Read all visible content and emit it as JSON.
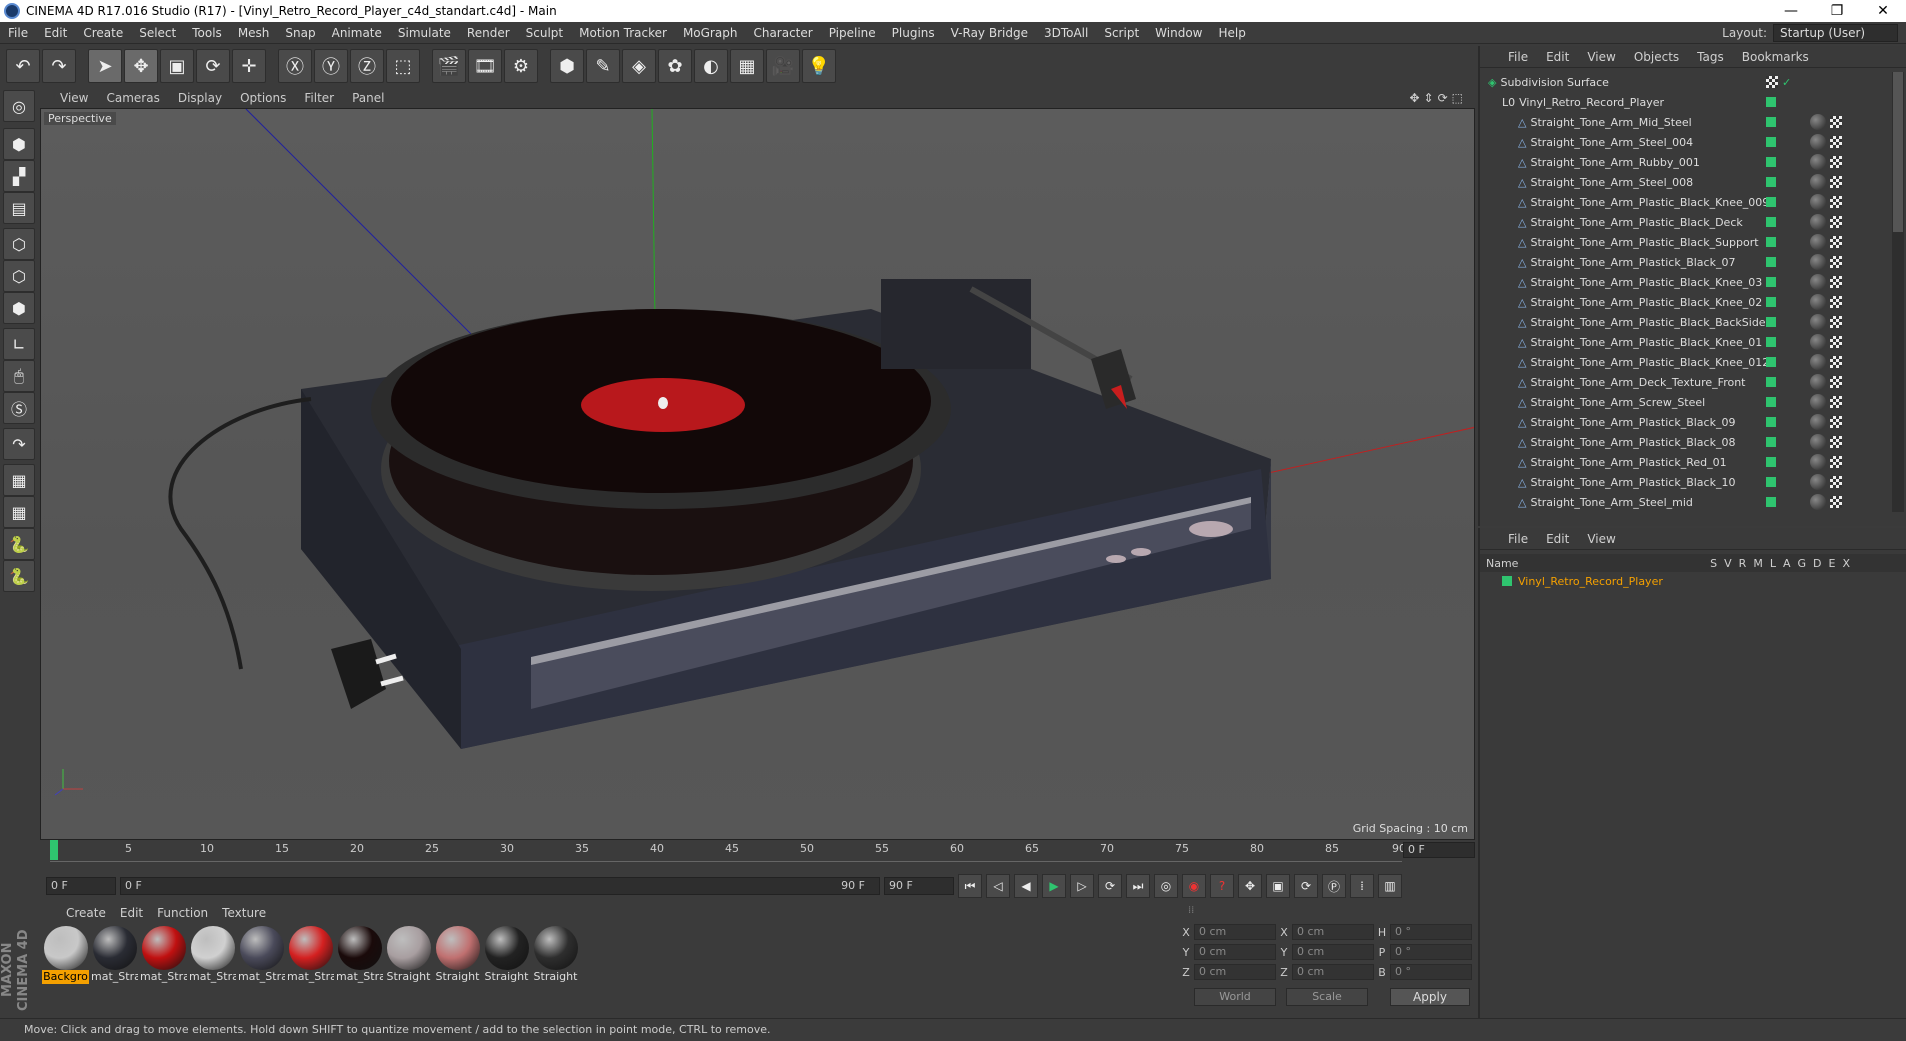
{
  "window": {
    "title": "CINEMA 4D R17.016 Studio (R17) - [Vinyl_Retro_Record_Player_c4d_standart.c4d] - Main"
  },
  "menu": [
    "File",
    "Edit",
    "Create",
    "Select",
    "Tools",
    "Mesh",
    "Snap",
    "Animate",
    "Simulate",
    "Render",
    "Sculpt",
    "Motion Tracker",
    "MoGraph",
    "Character",
    "Pipeline",
    "Plugins",
    "V-Ray Bridge",
    "3DToAll",
    "Script",
    "Window",
    "Help"
  ],
  "layout": {
    "label": "Layout:",
    "value": "Startup (User)"
  },
  "viewport": {
    "menu": [
      "View",
      "Cameras",
      "Display",
      "Options",
      "Filter",
      "Panel"
    ],
    "camera": "Perspective",
    "grid_spacing": "Grid Spacing : 10 cm"
  },
  "timeline": {
    "ticks": [
      "0",
      "5",
      "10",
      "15",
      "20",
      "25",
      "30",
      "35",
      "40",
      "45",
      "50",
      "55",
      "60",
      "65",
      "70",
      "75",
      "80",
      "85",
      "90"
    ],
    "current_frame": "0 F",
    "start": "0 F",
    "range_start": "0 F",
    "range_end": "90 F",
    "end": "90 F"
  },
  "materials": {
    "menu": [
      "Create",
      "Edit",
      "Function",
      "Texture"
    ],
    "items": [
      {
        "label": "Backgro",
        "color": "#c8c8c8"
      },
      {
        "label": "mat_Stra",
        "color": "#2a2c34"
      },
      {
        "label": "mat_Stra",
        "color": "#c01010"
      },
      {
        "label": "mat_Stra",
        "color": "#d0d0d0"
      },
      {
        "label": "mat_Stra",
        "color": "#4a4a5a"
      },
      {
        "label": "mat_Stra",
        "color": "#d42020"
      },
      {
        "label": "mat_Stra",
        "color": "#1a0a0a"
      },
      {
        "label": "Straight",
        "color": "#a89ea0"
      },
      {
        "label": "Straight",
        "color": "#c07070"
      },
      {
        "label": "Straight",
        "color": "#222"
      },
      {
        "label": "Straight",
        "color": "#2e2e2e"
      }
    ]
  },
  "coords": {
    "rows": [
      {
        "a": "X",
        "av": "0 cm",
        "b": "X",
        "bv": "0 cm",
        "c": "H",
        "cv": "0 °"
      },
      {
        "a": "Y",
        "av": "0 cm",
        "b": "Y",
        "bv": "0 cm",
        "c": "P",
        "cv": "0 °"
      },
      {
        "a": "Z",
        "av": "0 cm",
        "b": "Z",
        "bv": "0 cm",
        "c": "B",
        "cv": "0 °"
      }
    ],
    "mode": "World",
    "transform": "Scale",
    "apply": "Apply"
  },
  "status": "Move: Click and drag to move elements. Hold down SHIFT to quantize movement / add to the selection in point mode, CTRL to remove.",
  "object_manager": {
    "menu": [
      "File",
      "Edit",
      "View",
      "Objects",
      "Tags",
      "Bookmarks"
    ],
    "root": "Subdivision Surface",
    "group": "Vinyl_Retro_Record_Player",
    "items": [
      "Straight_Tone_Arm_Mid_Steel",
      "Straight_Tone_Arm_Steel_004",
      "Straight_Tone_Arm_Rubby_001",
      "Straight_Tone_Arm_Steel_008",
      "Straight_Tone_Arm_Plastic_Black_Knee_009",
      "Straight_Tone_Arm_Plastic_Black_Deck",
      "Straight_Tone_Arm_Plastic_Black_Support",
      "Straight_Tone_Arm_Plastick_Black_07",
      "Straight_Tone_Arm_Plastic_Black_Knee_03",
      "Straight_Tone_Arm_Plastic_Black_Knee_02",
      "Straight_Tone_Arm_Plastic_Black_BackSide",
      "Straight_Tone_Arm_Plastic_Black_Knee_01",
      "Straight_Tone_Arm_Plastic_Black_Knee_012",
      "Straight_Tone_Arm_Deck_Texture_Front",
      "Straight_Tone_Arm_Screw_Steel",
      "Straight_Tone_Arm_Plastick_Black_09",
      "Straight_Tone_Arm_Plastick_Black_08",
      "Straight_Tone_Arm_Plastick_Red_01",
      "Straight_Tone_Arm_Plastick_Black_10",
      "Straight_Tone_Arm_Steel_mid"
    ]
  },
  "attribute_manager": {
    "menu": [
      "File",
      "Edit",
      "View"
    ],
    "name_header": "Name",
    "columns": [
      "S",
      "V",
      "R",
      "M",
      "L",
      "A",
      "G",
      "D",
      "E",
      "X"
    ],
    "row": "Vinyl_Retro_Record_Player"
  }
}
